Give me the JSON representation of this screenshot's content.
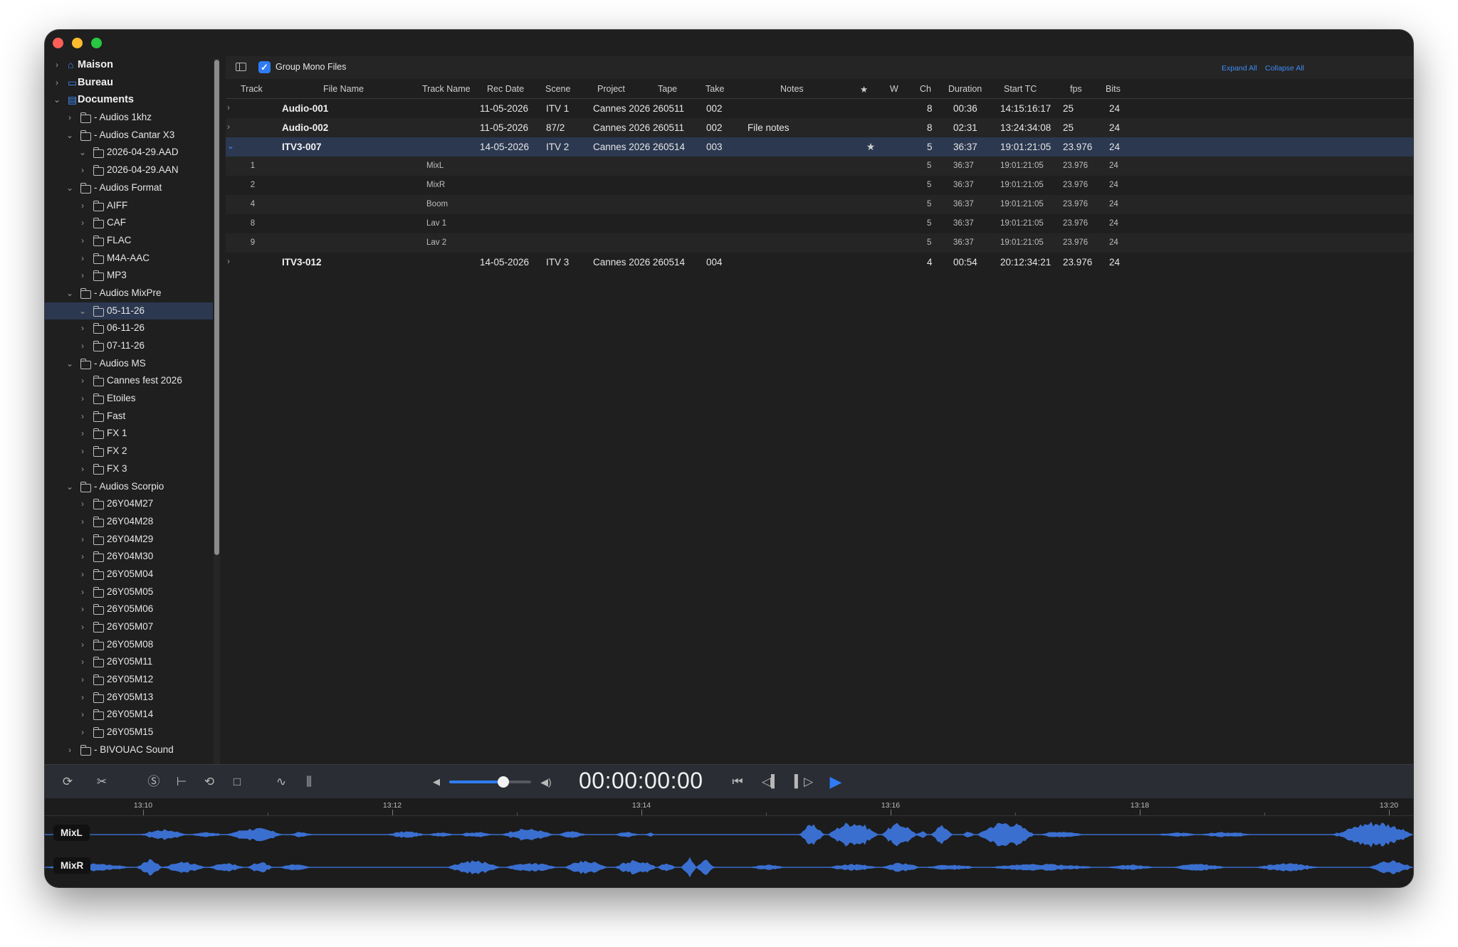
{
  "sidebar": {
    "items": [
      {
        "label": "Maison",
        "level": 0,
        "icon": "house-icon",
        "expanded": false,
        "top": true
      },
      {
        "label": "Bureau",
        "level": 0,
        "icon": "desktop-icon",
        "expanded": false,
        "top": true
      },
      {
        "label": "Documents",
        "level": 0,
        "icon": "document-icon",
        "expanded": true,
        "top": true
      },
      {
        "label": "- Audios 1khz",
        "level": 1,
        "icon": "folder-icon",
        "expanded": false
      },
      {
        "label": "- Audios Cantar X3",
        "level": 1,
        "icon": "folder-icon",
        "expanded": true
      },
      {
        "label": "2026-04-29.AAD",
        "level": 2,
        "icon": "folder-icon",
        "expanded": true
      },
      {
        "label": "2026-04-29.AAN",
        "level": 2,
        "icon": "folder-icon",
        "expanded": false
      },
      {
        "label": "- Audios Format",
        "level": 1,
        "icon": "folder-icon",
        "expanded": true
      },
      {
        "label": "AIFF",
        "level": 2,
        "icon": "folder-icon",
        "expanded": false
      },
      {
        "label": "CAF",
        "level": 2,
        "icon": "folder-icon",
        "expanded": false
      },
      {
        "label": "FLAC",
        "level": 2,
        "icon": "folder-icon",
        "expanded": false
      },
      {
        "label": "M4A-AAC",
        "level": 2,
        "icon": "folder-icon",
        "expanded": false
      },
      {
        "label": "MP3",
        "level": 2,
        "icon": "folder-icon",
        "expanded": false
      },
      {
        "label": "- Audios MixPre",
        "level": 1,
        "icon": "folder-icon",
        "expanded": true
      },
      {
        "label": "05-11-26",
        "level": 2,
        "icon": "folder-icon",
        "expanded": true,
        "selected": true
      },
      {
        "label": "06-11-26",
        "level": 2,
        "icon": "folder-icon",
        "expanded": false
      },
      {
        "label": "07-11-26",
        "level": 2,
        "icon": "folder-icon",
        "expanded": false
      },
      {
        "label": "- Audios MS",
        "level": 1,
        "icon": "folder-icon",
        "expanded": true
      },
      {
        "label": "Cannes fest 2026",
        "level": 2,
        "icon": "folder-icon",
        "expanded": false
      },
      {
        "label": "Etoiles",
        "level": 2,
        "icon": "folder-icon",
        "expanded": false
      },
      {
        "label": "Fast",
        "level": 2,
        "icon": "folder-icon",
        "expanded": false
      },
      {
        "label": "FX 1",
        "level": 2,
        "icon": "folder-icon",
        "expanded": false
      },
      {
        "label": "FX 2",
        "level": 2,
        "icon": "folder-icon",
        "expanded": false
      },
      {
        "label": "FX 3",
        "level": 2,
        "icon": "folder-icon",
        "expanded": false
      },
      {
        "label": "- Audios Scorpio",
        "level": 1,
        "icon": "folder-icon",
        "expanded": true
      },
      {
        "label": "26Y04M27",
        "level": 2,
        "icon": "folder-icon",
        "expanded": false
      },
      {
        "label": "26Y04M28",
        "level": 2,
        "icon": "folder-icon",
        "expanded": false
      },
      {
        "label": "26Y04M29",
        "level": 2,
        "icon": "folder-icon",
        "expanded": false
      },
      {
        "label": "26Y04M30",
        "level": 2,
        "icon": "folder-icon",
        "expanded": false
      },
      {
        "label": "26Y05M04",
        "level": 2,
        "icon": "folder-icon",
        "expanded": false
      },
      {
        "label": "26Y05M05",
        "level": 2,
        "icon": "folder-icon",
        "expanded": false
      },
      {
        "label": "26Y05M06",
        "level": 2,
        "icon": "folder-icon",
        "expanded": false
      },
      {
        "label": "26Y05M07",
        "level": 2,
        "icon": "folder-icon",
        "expanded": false
      },
      {
        "label": "26Y05M08",
        "level": 2,
        "icon": "folder-icon",
        "expanded": false
      },
      {
        "label": "26Y05M11",
        "level": 2,
        "icon": "folder-icon",
        "expanded": false
      },
      {
        "label": "26Y05M12",
        "level": 2,
        "icon": "folder-icon",
        "expanded": false
      },
      {
        "label": "26Y05M13",
        "level": 2,
        "icon": "folder-icon",
        "expanded": false
      },
      {
        "label": "26Y05M14",
        "level": 2,
        "icon": "folder-icon",
        "expanded": false
      },
      {
        "label": "26Y05M15",
        "level": 2,
        "icon": "folder-icon",
        "expanded": false
      },
      {
        "label": "- BIVOUAC Sound",
        "level": 1,
        "icon": "folder-icon",
        "expanded": false
      }
    ]
  },
  "toolbar": {
    "group_mono_label": "Group Mono Files",
    "group_mono_checked": true,
    "expand_all": "Expand All",
    "collapse_all": "Collapse All"
  },
  "table": {
    "columns": {
      "track": "Track",
      "file_name": "File Name",
      "track_name": "Track Name",
      "rec_date": "Rec Date",
      "scene": "Scene",
      "project": "Project",
      "tape": "Tape",
      "take": "Take",
      "notes": "Notes",
      "star": "★",
      "w": "W",
      "ch": "Ch",
      "duration": "Duration",
      "start_tc": "Start TC",
      "fps": "fps",
      "bits": "Bits"
    },
    "rows": [
      {
        "kind": "file",
        "expanded": false,
        "track": "",
        "file_name": "Audio-001",
        "track_name": "",
        "rec_date": "11-05-2026",
        "scene": "ITV 1",
        "project": "Cannes 2026",
        "tape": "260511",
        "take": "002",
        "notes": "",
        "star": "",
        "w": "",
        "ch": "8",
        "duration": "00:36",
        "start_tc": "14:15:16:17",
        "fps": "25",
        "bits": "24"
      },
      {
        "kind": "file",
        "expanded": false,
        "track": "",
        "file_name": "Audio-002",
        "track_name": "",
        "rec_date": "11-05-2026",
        "scene": "87/2",
        "project": "Cannes 2026",
        "tape": "260511",
        "take": "002",
        "notes": "File notes",
        "star": "",
        "w": "",
        "ch": "8",
        "duration": "02:31",
        "start_tc": "13:24:34:08",
        "fps": "25",
        "bits": "24"
      },
      {
        "kind": "file",
        "expanded": true,
        "selected": true,
        "track": "",
        "file_name": "ITV3-007",
        "track_name": "",
        "rec_date": "14-05-2026",
        "scene": "ITV 2",
        "project": "Cannes 2026",
        "tape": "260514",
        "take": "003",
        "notes": "",
        "star": "★",
        "w": "",
        "ch": "5",
        "duration": "36:37",
        "start_tc": "19:01:21:05",
        "fps": "23.976",
        "bits": "24"
      },
      {
        "kind": "child",
        "track": "1",
        "file_name": "",
        "track_name": "MixL",
        "rec_date": "",
        "scene": "",
        "project": "",
        "tape": "",
        "take": "",
        "notes": "",
        "star": "",
        "w": "",
        "ch": "5",
        "duration": "36:37",
        "start_tc": "19:01:21:05",
        "fps": "23.976",
        "bits": "24"
      },
      {
        "kind": "child",
        "track": "2",
        "file_name": "",
        "track_name": "MixR",
        "rec_date": "",
        "scene": "",
        "project": "",
        "tape": "",
        "take": "",
        "notes": "",
        "star": "",
        "w": "",
        "ch": "5",
        "duration": "36:37",
        "start_tc": "19:01:21:05",
        "fps": "23.976",
        "bits": "24"
      },
      {
        "kind": "child",
        "track": "4",
        "file_name": "",
        "track_name": "Boom",
        "rec_date": "",
        "scene": "",
        "project": "",
        "tape": "",
        "take": "",
        "notes": "",
        "star": "",
        "w": "",
        "ch": "5",
        "duration": "36:37",
        "start_tc": "19:01:21:05",
        "fps": "23.976",
        "bits": "24"
      },
      {
        "kind": "child",
        "track": "8",
        "file_name": "",
        "track_name": "Lav 1",
        "rec_date": "",
        "scene": "",
        "project": "",
        "tape": "",
        "take": "",
        "notes": "",
        "star": "",
        "w": "",
        "ch": "5",
        "duration": "36:37",
        "start_tc": "19:01:21:05",
        "fps": "23.976",
        "bits": "24"
      },
      {
        "kind": "child",
        "track": "9",
        "file_name": "",
        "track_name": "Lav 2",
        "rec_date": "",
        "scene": "",
        "project": "",
        "tape": "",
        "take": "",
        "notes": "",
        "star": "",
        "w": "",
        "ch": "5",
        "duration": "36:37",
        "start_tc": "19:01:21:05",
        "fps": "23.976",
        "bits": "24"
      },
      {
        "kind": "file",
        "expanded": false,
        "track": "",
        "file_name": "ITV3-012",
        "track_name": "",
        "rec_date": "14-05-2026",
        "scene": "ITV 3",
        "project": "Cannes 2026",
        "tape": "260514",
        "take": "004",
        "notes": "",
        "star": "",
        "w": "",
        "ch": "4",
        "duration": "00:54",
        "start_tc": "20:12:34:21",
        "fps": "23.976",
        "bits": "24"
      }
    ]
  },
  "transport": {
    "timecode": "00:00:00:00",
    "volume": 0.66,
    "icons": [
      "autoplay-icon",
      "tools-icon",
      "solo-icon",
      "cue-icon",
      "loop-icon",
      "stop-icon",
      "waveform-icon",
      "mixer-icon",
      "volume-low-icon",
      "volume-high-icon",
      "skip-to-start-icon",
      "step-back-icon",
      "step-forward-icon",
      "play-icon"
    ]
  },
  "waveform": {
    "ruler_labels": [
      "13:10",
      "13:12",
      "13:14",
      "13:16",
      "13:18",
      "13:20"
    ],
    "channels": [
      "MixL",
      "MixR"
    ],
    "color": "#3a6fd0"
  },
  "colors": {
    "accent": "#2f7cf6",
    "selection": "#2b3850",
    "window_bg": "#1f1f1f"
  }
}
